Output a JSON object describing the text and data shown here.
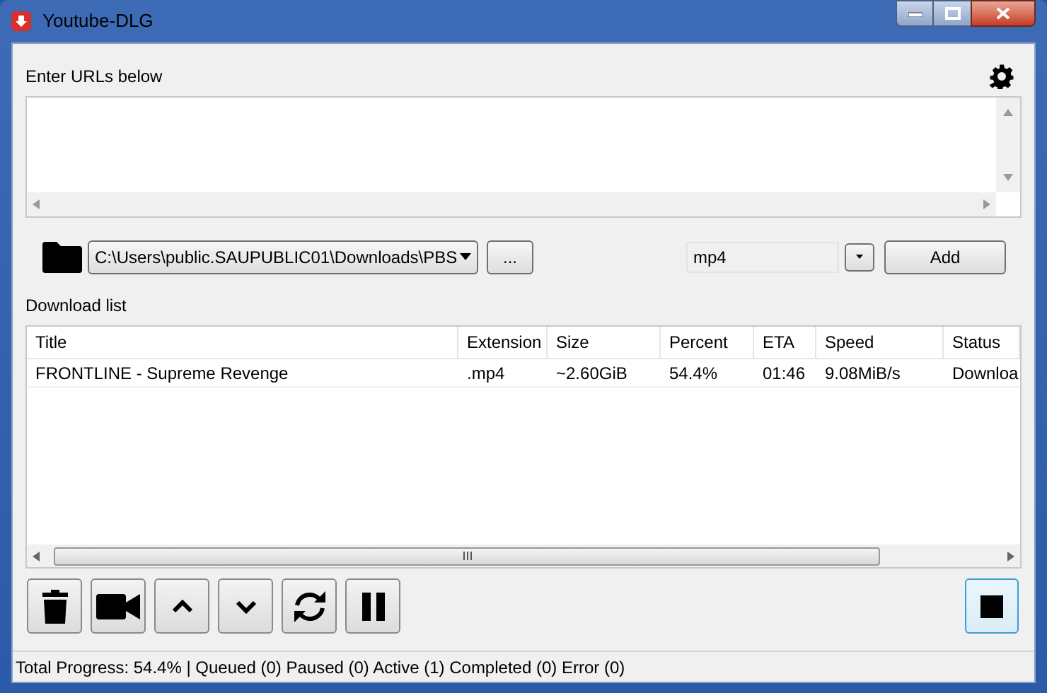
{
  "window": {
    "title": "Youtube-DLG"
  },
  "url_label": "Enter URLs below",
  "path": {
    "value": "C:\\Users\\public.SAUPUBLIC01\\Downloads\\PBS",
    "browse_label": "..."
  },
  "format": {
    "value": "mp4",
    "add_label": "Add"
  },
  "list_label": "Download list",
  "table": {
    "columns": [
      "Title",
      "Extension",
      "Size",
      "Percent",
      "ETA",
      "Speed",
      "Status"
    ],
    "rows": [
      [
        "FRONTLINE - Supreme Revenge",
        ".mp4",
        "~2.60GiB",
        "54.4%",
        "01:46",
        "9.08MiB/s",
        "Downloa"
      ]
    ]
  },
  "status_bar": "Total Progress: 54.4% | Queued (0) Paused (0) Active (1) Completed (0) Error (0)"
}
